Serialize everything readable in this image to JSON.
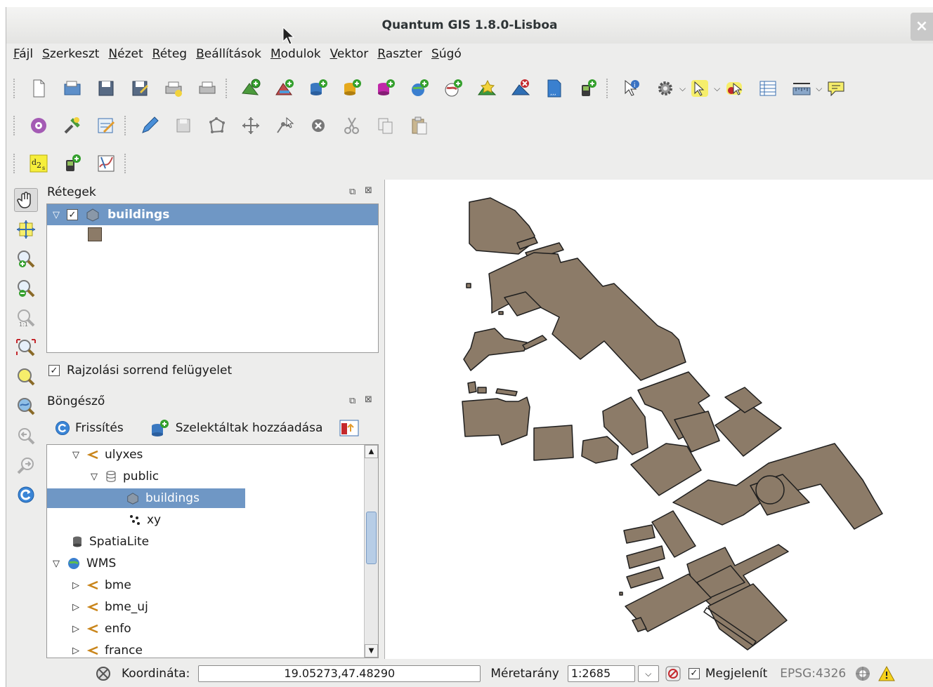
{
  "window": {
    "title": "Quantum GIS 1.8.0-Lisboa",
    "close_glyph": "×"
  },
  "menu": [
    "Fájl",
    "Szerkeszt",
    "Nézet",
    "Réteg",
    "Beállítások",
    "Modulok",
    "Vektor",
    "Raszter",
    "Súgó"
  ],
  "layers_panel": {
    "title": "Rétegek",
    "layer_name": "buildings",
    "draw_order_label": "Rajzolási sorrend felügyelet",
    "layer_color": "#8c7b68"
  },
  "browser_panel": {
    "title": "Böngésző",
    "refresh_label": "Frissítés",
    "add_selected_label": "Szelektáltak hozzáadása",
    "tree": [
      {
        "label": "ulyxes",
        "icon": "postgis-connection-icon"
      },
      {
        "label": "public",
        "icon": "schema-icon"
      },
      {
        "label": "buildings",
        "icon": "polygon-layer-icon"
      },
      {
        "label": "xy",
        "icon": "point-layer-icon"
      },
      {
        "label": "SpatiaLite",
        "icon": "spatialite-icon"
      },
      {
        "label": "WMS",
        "icon": "wms-globe-icon"
      },
      {
        "label": "bme",
        "icon": "connection-icon"
      },
      {
        "label": "bme_uj",
        "icon": "connection-icon"
      },
      {
        "label": "enfo",
        "icon": "connection-icon"
      },
      {
        "label": "france",
        "icon": "connection-icon"
      }
    ]
  },
  "status": {
    "coord_label": "Koordináta:",
    "coord_value": "19.05273,47.48290",
    "scale_label": "Méretarány",
    "scale_value": "1:2685",
    "render_label": "Megjelenít",
    "crs": "EPSG:4326"
  },
  "colors": {
    "selection": "#6f97c5",
    "building_fill": "#8c7b68",
    "building_stroke": "#1e1e1e"
  }
}
